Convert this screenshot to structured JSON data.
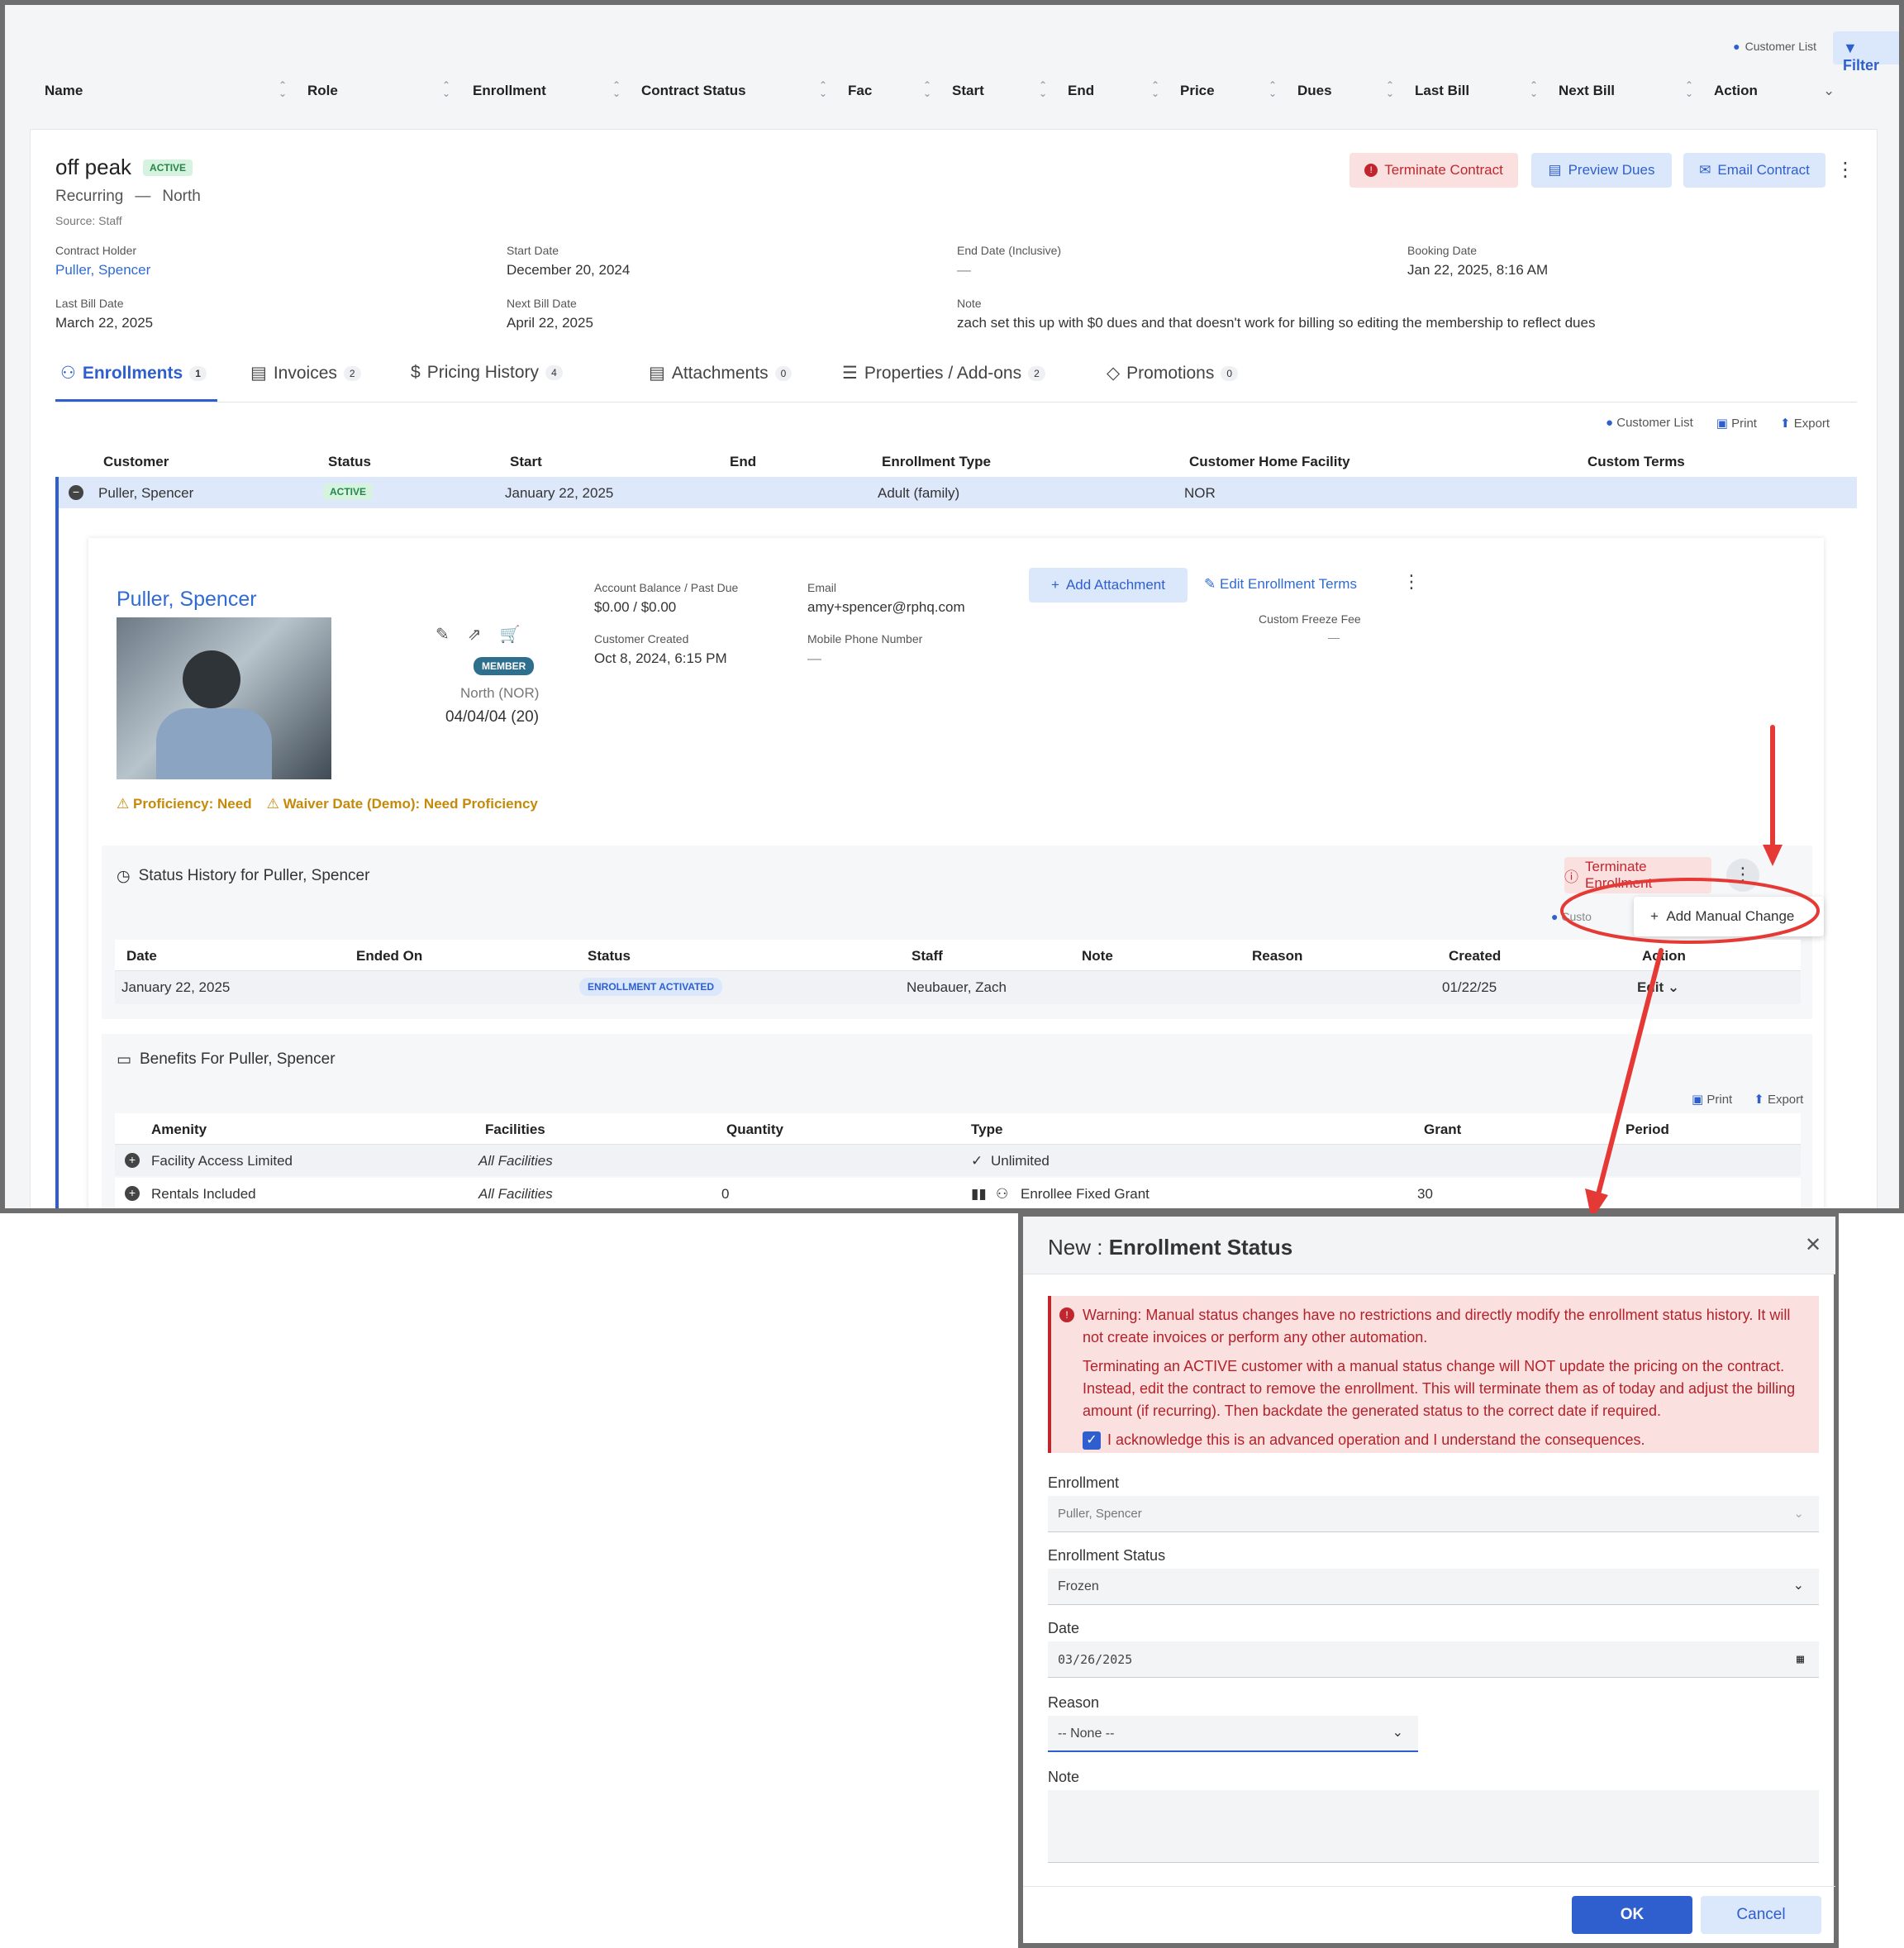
{
  "header": {
    "customer_list": "Customer List",
    "filter": "Filter"
  },
  "columns": [
    "Name",
    "Role",
    "Enrollment",
    "Contract Status",
    "Fac",
    "Start",
    "End",
    "Price",
    "Dues",
    "Last Bill",
    "Next Bill",
    "Action"
  ],
  "contract": {
    "title": "off peak",
    "status": "ACTIVE",
    "type": "Recurring",
    "dash": "—",
    "location": "North",
    "source": "Source: Staff",
    "buttons": {
      "terminate": "Terminate Contract",
      "preview": "Preview Dues",
      "email": "Email Contract"
    },
    "fields": {
      "holder_label": "Contract Holder",
      "holder": "Puller, Spencer",
      "start_label": "Start Date",
      "start": "December 20, 2024",
      "end_label": "End Date (Inclusive)",
      "end": "—",
      "booking_label": "Booking Date",
      "booking": "Jan 22, 2025, 8:16 AM",
      "lastbill_label": "Last Bill Date",
      "lastbill": "March 22, 2025",
      "nextbill_label": "Next Bill Date",
      "nextbill": "April 22, 2025",
      "note_label": "Note",
      "note": "zach set this up with $0 dues and that doesn't work for billing so editing the membership to reflect dues"
    }
  },
  "tabs": [
    {
      "label": "Enrollments",
      "count": "1"
    },
    {
      "label": "Invoices",
      "count": "2"
    },
    {
      "label": "Pricing History",
      "count": "4"
    },
    {
      "label": "Attachments",
      "count": "0"
    },
    {
      "label": "Properties / Add-ons",
      "count": "2"
    },
    {
      "label": "Promotions",
      "count": "0"
    }
  ],
  "toolbar": {
    "customer_list": "Customer List",
    "print": "Print",
    "export": "Export"
  },
  "enroll_cols": [
    "Customer",
    "Status",
    "Start",
    "End",
    "Enrollment Type",
    "Customer Home Facility",
    "Custom Terms"
  ],
  "enroll_row": {
    "customer": "Puller, Spencer",
    "status": "ACTIVE",
    "start": "January 22, 2025",
    "type": "Adult (family)",
    "facility": "NOR"
  },
  "detail": {
    "name": "Puller, Spencer",
    "member": "MEMBER",
    "home": "North (NOR)",
    "dob": "04/04/04 (20)",
    "balance_label": "Account Balance / Past Due",
    "balance": "$0.00 / $0.00",
    "created_label": "Customer Created",
    "created": "Oct 8, 2024, 6:15 PM",
    "email_label": "Email",
    "email": "amy+spencer@rphq.com",
    "phone_label": "Mobile Phone Number",
    "phone": "—",
    "add_attachment": "Add Attachment",
    "edit_terms": "Edit Enrollment Terms",
    "freeze_label": "Custom Freeze Fee",
    "freeze": "—",
    "warn1": "Proficiency: Need",
    "warn2": "Waiver Date (Demo): Need Proficiency"
  },
  "status_history": {
    "title": "Status History for Puller, Spencer",
    "terminate": "Terminate Enrollment",
    "custom": "Custo",
    "add_manual": "Add Manual Change",
    "cols": [
      "Date",
      "Ended On",
      "Status",
      "Staff",
      "Note",
      "Reason",
      "Created",
      "Action"
    ],
    "row": {
      "date": "January 22, 2025",
      "status": "ENROLLMENT ACTIVATED",
      "staff": "Neubauer, Zach",
      "created": "01/22/25",
      "action": "Edit"
    }
  },
  "benefits": {
    "title": "Benefits For Puller, Spencer",
    "print": "Print",
    "export": "Export",
    "cols": [
      "Amenity",
      "Facilities",
      "Quantity",
      "Type",
      "Grant",
      "Period"
    ],
    "rows": [
      {
        "amenity": "Facility Access Limited",
        "facilities": "All Facilities",
        "quantity": "",
        "type": "Unlimited",
        "grant": ""
      },
      {
        "amenity": "Rentals Included",
        "facilities": "All Facilities",
        "quantity": "0",
        "type": "Enrollee Fixed Grant",
        "grant": "30"
      }
    ]
  },
  "modal": {
    "title_prefix": "New :",
    "title": "Enrollment Status",
    "warning1": "Warning: Manual status changes have no restrictions and directly modify the enrollment status history. It will not create invoices or perform any other automation.",
    "warning2": "Terminating an ACTIVE customer with a manual status change will NOT update the pricing on the contract. Instead, edit the contract to remove the enrollment. This will terminate them as of today and adjust the billing amount (if recurring). Then backdate the generated status to the correct date if required.",
    "ack": "I acknowledge this is an advanced operation and I understand the consequences.",
    "enrollment_label": "Enrollment",
    "enrollment": "Puller, Spencer",
    "status_label": "Enrollment Status",
    "status": "Frozen",
    "date_label": "Date",
    "date": "03/26/2025",
    "reason_label": "Reason",
    "reason": "-- None --",
    "note_label": "Note",
    "ok": "OK",
    "cancel": "Cancel"
  },
  "colors": {
    "accent": "#2f5fcf",
    "danger": "#c0262d",
    "annotation": "#e53935"
  }
}
